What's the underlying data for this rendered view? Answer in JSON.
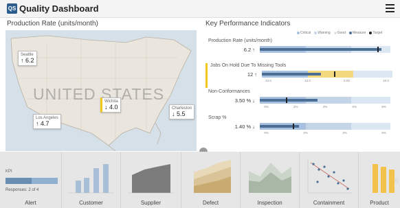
{
  "app": {
    "title": "Quality Dashboard",
    "logo": "QS"
  },
  "map_panel": {
    "title": "Production Rate (units/month)",
    "country_label": "UNITED STATES",
    "cities": [
      {
        "name": "Seattle",
        "value": "6.2",
        "arrow": "↑"
      },
      {
        "name": "Wichita",
        "value": "4.0",
        "arrow": "↓",
        "selected": true
      },
      {
        "name": "Los Angeles",
        "value": "4.7",
        "arrow": "↑"
      },
      {
        "name": "Charleston",
        "value": "5.5",
        "arrow": "↓"
      }
    ]
  },
  "kpi_panel": {
    "title": "Key Performance Indicators",
    "legend": [
      {
        "label": "Critical",
        "color": "#a9c1e0"
      },
      {
        "label": "Warning",
        "color": "#c4d5ea"
      },
      {
        "label": "Good",
        "color": "#dde7f4"
      },
      {
        "label": "Measure",
        "color": "#4b6e94"
      },
      {
        "label": "Target",
        "color": "#222222"
      }
    ],
    "rows": [
      {
        "name": "Production Rate (units/month)",
        "value": "6.2",
        "arrow": "↑",
        "ticks": [],
        "measure": 0.93,
        "target": 0.9
      },
      {
        "name": "Jobs On Hold Due To Missing Tools",
        "value": "12",
        "arrow": "↑",
        "ticks": [
          "10.0",
          "12.0",
          "5.00",
          "10.0"
        ],
        "measure": 0.45,
        "target": 0.55,
        "selected": true
      },
      {
        "name": "Non-Conformances",
        "value": "3.50 %",
        "arrow": "↓",
        "ticks": [
          "0%",
          "2%",
          "4%",
          "6%",
          "8%"
        ],
        "measure": 0.44,
        "target": 0.2
      },
      {
        "name": "Scrap %",
        "value": "1.40 %",
        "arrow": "↓",
        "ticks": [
          "0%",
          "2%",
          "3%",
          "5%"
        ],
        "measure": 0.3,
        "target": 0.25
      }
    ]
  },
  "toggle": {
    "icon": "chevron-down-icon",
    "glyph": "⌄"
  },
  "tiles": [
    {
      "label": "Alert",
      "kpi": "KPI",
      "responses": "Responses: 2 of 4",
      "progress": 0.5
    },
    {
      "label": "Customer"
    },
    {
      "label": "Supplier"
    },
    {
      "label": "Defect"
    },
    {
      "label": "Inspection"
    },
    {
      "label": "Containment"
    },
    {
      "label": "Product"
    }
  ],
  "next_icon": "chevron-right-icon",
  "next_glyph": "›"
}
